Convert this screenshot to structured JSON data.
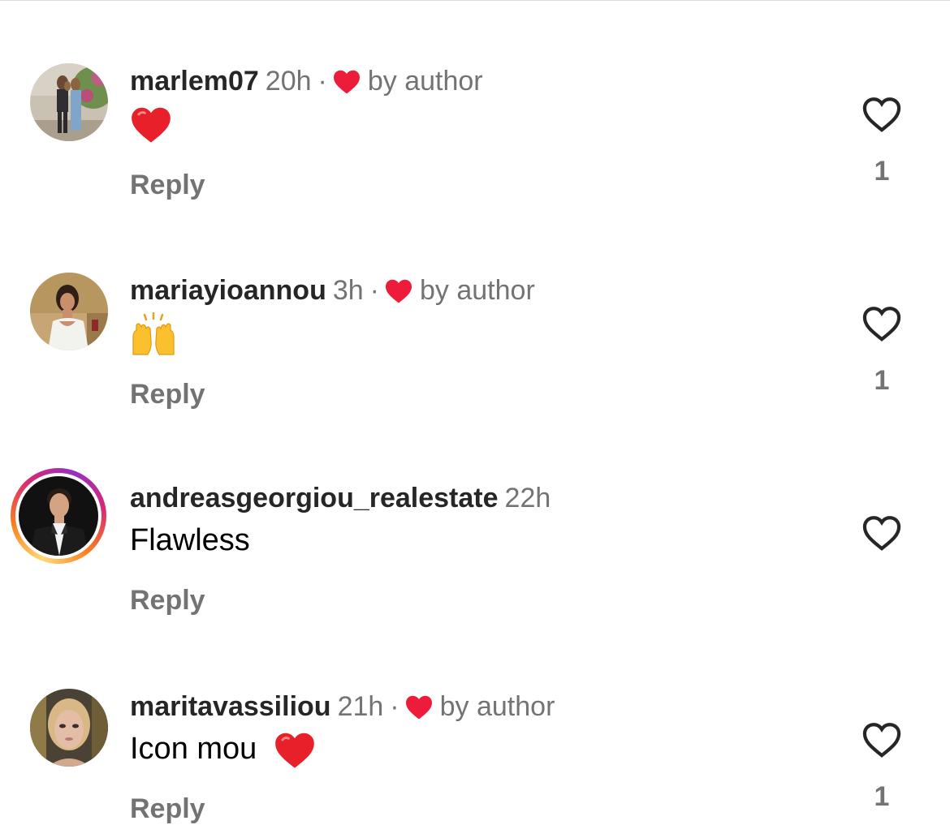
{
  "comments": [
    {
      "username": "marlem07",
      "time": "20h",
      "separator": "·",
      "author_badge": "by author",
      "liked_by_author": true,
      "text": "",
      "emoji": "red-heart",
      "reply_label": "Reply",
      "like_count": "1",
      "avatar": "group-photo-avatar",
      "story_ring": false
    },
    {
      "username": "mariayioannou",
      "time": "3h",
      "separator": "·",
      "author_badge": "by author",
      "liked_by_author": true,
      "text": "",
      "emoji": "raising-hands",
      "reply_label": "Reply",
      "like_count": "1",
      "avatar": "woman-white-dress-avatar",
      "story_ring": false
    },
    {
      "username": "andreasgeorgiou_realestate",
      "time": "22h",
      "separator": "",
      "author_badge": "",
      "liked_by_author": false,
      "text": "Flawless",
      "emoji": "",
      "reply_label": "Reply",
      "like_count": "",
      "avatar": "man-black-suit-avatar",
      "story_ring": true
    },
    {
      "username": "maritavassiliou",
      "time": "21h",
      "separator": "·",
      "author_badge": "by author",
      "liked_by_author": true,
      "text": "Icon mou",
      "emoji": "red-heart",
      "reply_label": "Reply",
      "like_count": "1",
      "avatar": "blonde-woman-avatar",
      "story_ring": false
    }
  ],
  "colors": {
    "author_heart": "#ed1c3b",
    "secondary_text": "#737373",
    "username_text": "#262626",
    "like_outline": "#262626"
  }
}
